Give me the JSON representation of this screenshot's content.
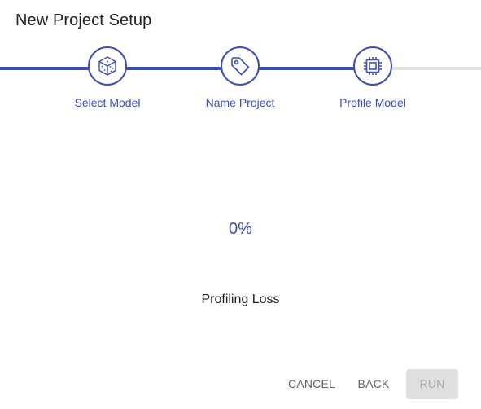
{
  "dialog": {
    "title": "New Project Setup"
  },
  "stepper": {
    "steps": [
      {
        "label": "Select Model",
        "icon": "cube-icon"
      },
      {
        "label": "Name Project",
        "icon": "tag-icon"
      },
      {
        "label": "Profile Model",
        "icon": "chip-icon"
      }
    ]
  },
  "profiling": {
    "percent": "0%",
    "status": "Profiling Loss"
  },
  "actions": {
    "cancel": "CANCEL",
    "back": "BACK",
    "run": "RUN"
  },
  "colors": {
    "accent": "#3f4db3",
    "inactive_track": "#e3e3e3",
    "disabled_button": "#e0e0e0"
  }
}
